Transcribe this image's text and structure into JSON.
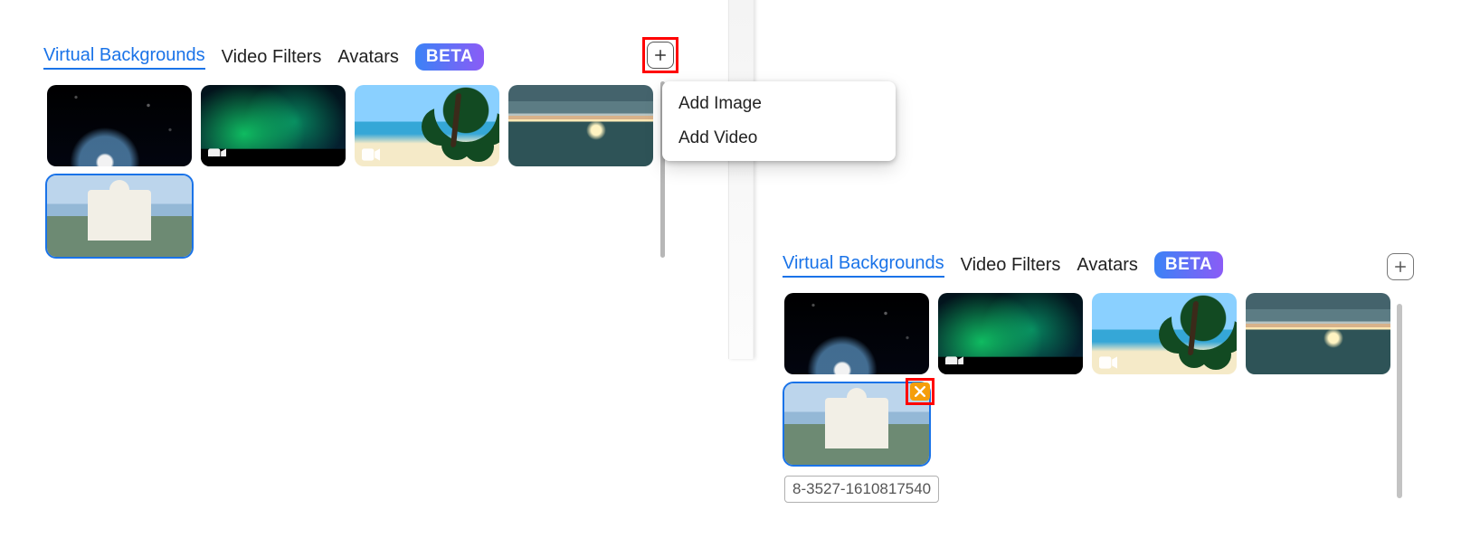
{
  "panelA": {
    "tabs": [
      {
        "label": "Virtual Backgrounds",
        "active": true
      },
      {
        "label": "Video Filters",
        "active": false
      },
      {
        "label": "Avatars",
        "active": false
      }
    ],
    "beta_label": "BETA",
    "dropdown": {
      "items": [
        {
          "label": "Add Image"
        },
        {
          "label": "Add Video"
        }
      ]
    },
    "thumbnails": [
      {
        "name": "bg-earth",
        "video": false,
        "selected": false
      },
      {
        "name": "bg-aurora",
        "video": true,
        "selected": false
      },
      {
        "name": "bg-beach",
        "video": true,
        "selected": false
      },
      {
        "name": "bg-sea",
        "video": false,
        "selected": false
      },
      {
        "name": "bg-capitol",
        "video": false,
        "selected": true
      }
    ]
  },
  "panelB": {
    "tabs": [
      {
        "label": "Virtual Backgrounds",
        "active": true
      },
      {
        "label": "Video Filters",
        "active": false
      },
      {
        "label": "Avatars",
        "active": false
      }
    ],
    "beta_label": "BETA",
    "thumbnails": [
      {
        "name": "bg-earth",
        "video": false,
        "selected": false,
        "deletable": false
      },
      {
        "name": "bg-aurora",
        "video": true,
        "selected": false,
        "deletable": false
      },
      {
        "name": "bg-beach",
        "video": true,
        "selected": false,
        "deletable": false
      },
      {
        "name": "bg-sea",
        "video": false,
        "selected": false,
        "deletable": false
      },
      {
        "name": "bg-capitol",
        "video": false,
        "selected": true,
        "deletable": true
      }
    ],
    "selected_caption": "8-3527-1610817540"
  }
}
